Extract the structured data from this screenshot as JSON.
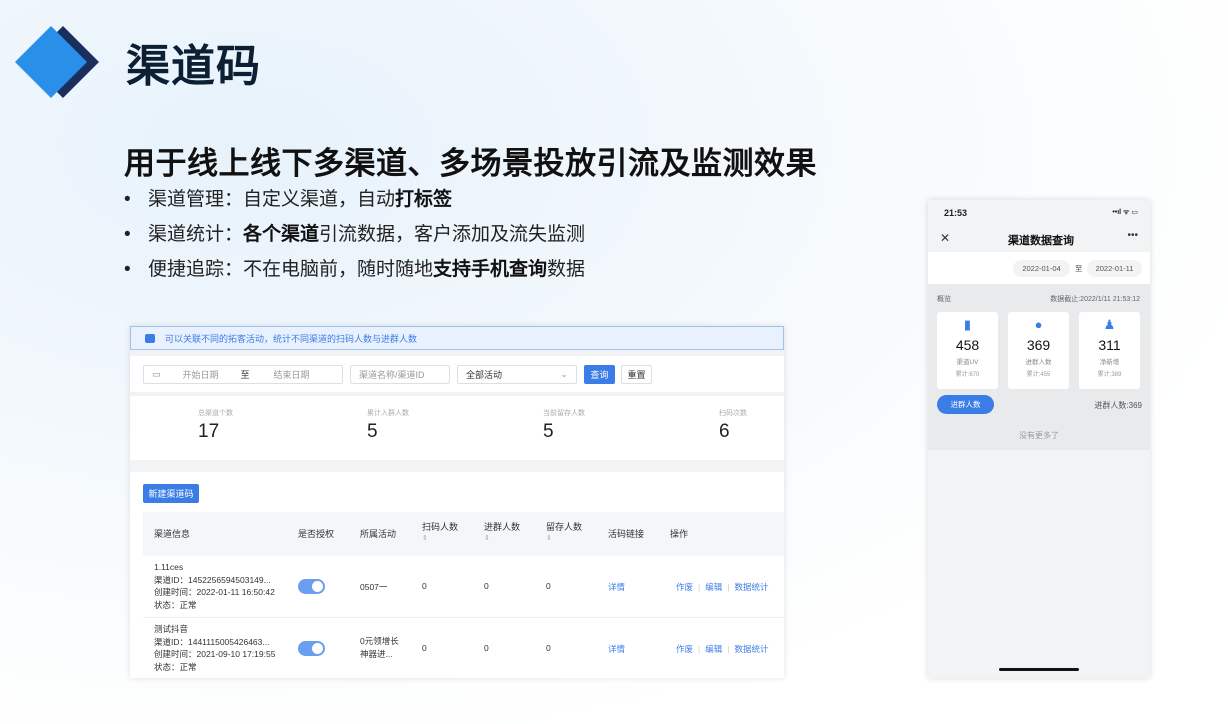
{
  "slide": {
    "title": "渠道码",
    "subtitle": "用于线上线下多渠道、多场景投放引流及监测效果",
    "bullets": [
      {
        "pre": "渠道管理：自定义渠道，自动",
        "bold": "打标签",
        "post": ""
      },
      {
        "pre": "渠道统计：",
        "bold": "各个渠道",
        "post": "引流数据，客户添加及流失监测"
      },
      {
        "pre": "便捷追踪：不在电脑前，随时随地",
        "bold": "支持手机查询",
        "post": "数据"
      }
    ],
    "accent_colors": {
      "primary": "#2a8fe8",
      "dark": "#1a2f5e"
    }
  },
  "web": {
    "notice": "可以关联不同的拓客活动，统计不同渠道的扫码人数与进群人数",
    "filters": {
      "start_placeholder": "开始日期",
      "to": "至",
      "end_placeholder": "结束日期",
      "name_placeholder": "渠道名称/渠道ID",
      "activity_select": "全部活动",
      "query_button": "查询",
      "reset_button": "重置"
    },
    "stats": [
      {
        "label": "总渠道个数",
        "value": "17"
      },
      {
        "label": "累计入群人数",
        "value": "5"
      },
      {
        "label": "当前留存人数",
        "value": "5"
      },
      {
        "label": "扫码次数",
        "value": "6"
      }
    ],
    "new_button": "新建渠道码",
    "columns": [
      "渠道信息",
      "是否授权",
      "所属活动",
      "扫码人数",
      "进群人数",
      "留存人数",
      "活码链接",
      "操作"
    ],
    "sort_glyph": "⇕",
    "rows": [
      {
        "name": "1.11ces",
        "id": "渠道ID：1452256594503149...",
        "created": "创建时间：2022-01-11 16:50:42",
        "status": "状态：正常",
        "activity": [
          "0507一",
          ""
        ],
        "scans": "0",
        "joins": "0",
        "retained": "0",
        "link": "详情",
        "actions": [
          "作废",
          "编辑",
          "数据统计"
        ]
      },
      {
        "name": "测试抖音",
        "id": "渠道ID：1441115005426463...",
        "created": "创建时间：2021-09-10 17:19:55",
        "status": "状态：正常",
        "activity": [
          "0元领增长",
          "神器进..."
        ],
        "scans": "0",
        "joins": "0",
        "retained": "0",
        "link": "详情",
        "actions": [
          "作废",
          "编辑",
          "数据统计"
        ]
      }
    ]
  },
  "phone": {
    "time": "21:53",
    "status_icons": "••ıl ᯤ ▭",
    "title": "渠道数据查询",
    "close": "✕",
    "more": "•••",
    "date_from": "2022-01-04",
    "date_to_label": "至",
    "date_to": "2022-01-11",
    "overview_label": "概览",
    "updated": "数据截止:2022/1/11 21:53:12",
    "cards": [
      {
        "icon": "▮",
        "value": "458",
        "label": "渠道UV",
        "total": "累计:670"
      },
      {
        "icon": "●",
        "value": "369",
        "label": "进群人数",
        "total": "累计:455"
      },
      {
        "icon": "♟",
        "value": "311",
        "label": "净新增",
        "total": "累计:389"
      }
    ],
    "join_button": "进群人数",
    "join_count": "进群人数:369",
    "no_more": "没有更多了"
  }
}
